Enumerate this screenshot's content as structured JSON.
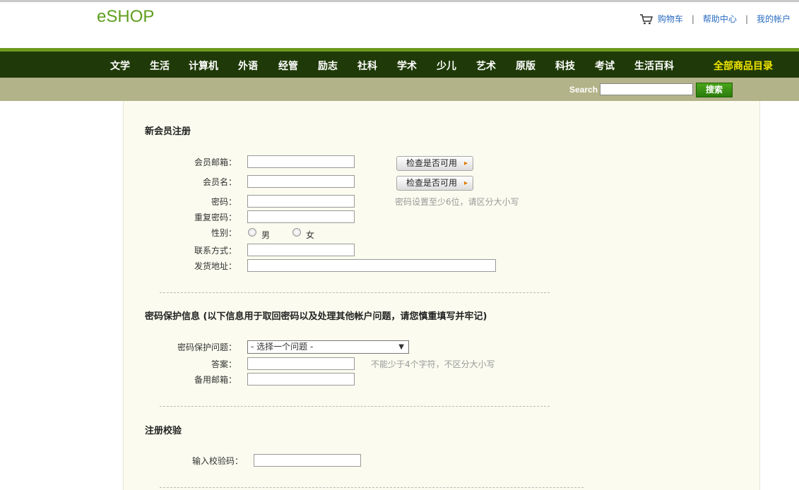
{
  "brand": {
    "logo": "eSHOP",
    "accent": "#5f9e1e"
  },
  "toplinks": {
    "cart": "购物车",
    "help": "帮助中心",
    "account": "我的帐户",
    "separator": "|"
  },
  "nav": {
    "items": [
      "文学",
      "生活",
      "计算机",
      "外语",
      "经管",
      "励志",
      "社科",
      "学术",
      "少儿",
      "艺术",
      "原版",
      "科技",
      "考试",
      "生活百科"
    ],
    "all": "全部商品目录",
    "bg_color": "#1f3a08"
  },
  "search": {
    "label": "Search",
    "value": "",
    "button": "搜索"
  },
  "register": {
    "title": "新会员注册",
    "email_label": "会员邮箱：",
    "username_label": "会员名：",
    "check_label": "检查是否可用",
    "password_label": "密码：",
    "password_hint": "密码设置至少6位，请区分大小写",
    "repeat_password_label": "重复密码：",
    "gender_label": "性别：",
    "gender_male": "男",
    "gender_female": "女",
    "contact_label": "联系方式：",
    "address_label": "发货地址："
  },
  "security": {
    "title": "密码保护信息 (以下信息用于取回密码以及处理其他帐户问题，请您慎重填写并牢记)",
    "question_label": "密码保护问题：",
    "question_selected": "- 选择一个问题 -",
    "answer_label": "答案：",
    "answer_hint": "不能少于4个字符，不区分大小写",
    "backup_email_label": "备用邮箱："
  },
  "verify": {
    "title": "注册校验",
    "code_label": "输入校验码："
  }
}
